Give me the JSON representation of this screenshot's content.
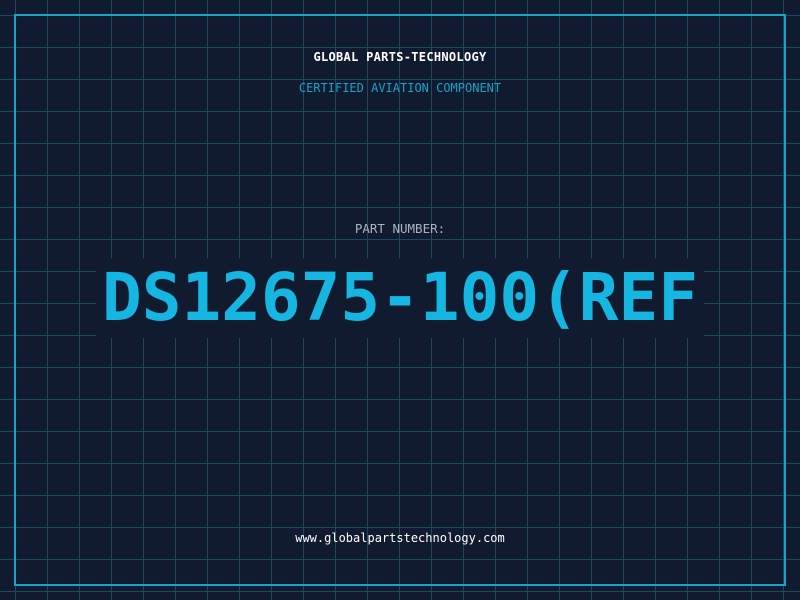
{
  "header": {
    "company_name": "GLOBAL PARTS-TECHNOLOGY",
    "subtitle": "CERTIFIED AVIATION COMPONENT"
  },
  "part": {
    "label": "PART NUMBER:",
    "number": "DS12675-100(REF"
  },
  "footer": {
    "website": "www.globalpartstechnology.com"
  },
  "colors": {
    "background": "#101b30",
    "grid": "#1d4a5e",
    "accent": "#1aa3c8",
    "part_number": "#16b6e2",
    "text": "#ffffff"
  }
}
